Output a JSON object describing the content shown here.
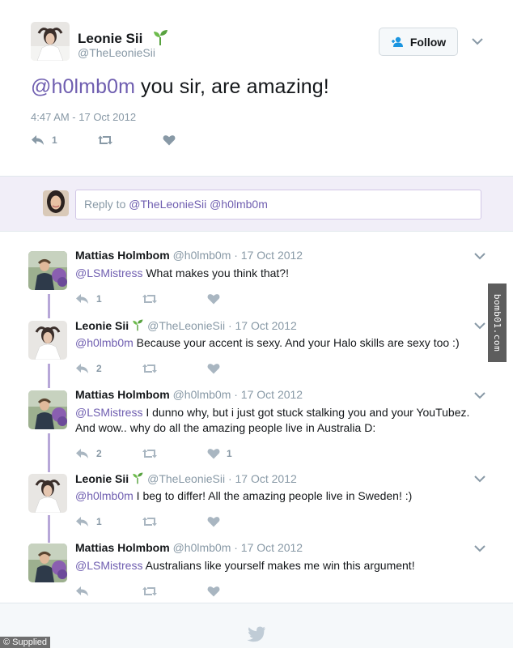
{
  "main_tweet": {
    "author_name": "Leonie Sii",
    "author_handle": "@TheLeonieSii",
    "follow_label": "Follow",
    "text_mention": "@h0lmb0m",
    "text_body": " you sir, are amazing!",
    "timestamp": "4:47 AM - 17 Oct 2012",
    "reply_count": "1",
    "like_count": ""
  },
  "reply_box": {
    "prefix": "Reply to ",
    "mention1": "@TheLeonieSii",
    "mention2": " @h0lmb0m"
  },
  "replies": [
    {
      "name": "Mattias Holmbom",
      "verified_sprout": false,
      "meta": "@h0lmb0m · 17 Oct 2012",
      "mention": "@LSMistress",
      "text": " What makes you think that?!",
      "reply_count": "1",
      "like_count": ""
    },
    {
      "name": "Leonie Sii",
      "verified_sprout": true,
      "meta": "@TheLeonieSii · 17 Oct 2012",
      "mention": "@h0lmb0m",
      "text": " Because your accent is sexy. And your Halo skills are sexy too :)",
      "reply_count": "2",
      "like_count": ""
    },
    {
      "name": "Mattias Holmbom",
      "verified_sprout": false,
      "meta": "@h0lmb0m · 17 Oct 2012",
      "mention": "@LSMistress",
      "text": " I dunno why, but i just got stuck stalking you and your YouTubez. And wow.. why do all the amazing people live in Australia D:",
      "reply_count": "2",
      "like_count": "1"
    },
    {
      "name": "Leonie Sii",
      "verified_sprout": true,
      "meta": "@TheLeonieSii · 17 Oct 2012",
      "mention": "@h0lmb0m",
      "text": " I beg to differ! All the amazing people live in Sweden! :)",
      "reply_count": "1",
      "like_count": ""
    },
    {
      "name": "Mattias Holmbom",
      "verified_sprout": false,
      "meta": "@h0lmb0m · 17 Oct 2012",
      "mention": "@LSMistress",
      "text": " Australians like yourself makes me win this argument!",
      "reply_count": "",
      "like_count": ""
    }
  ],
  "watermark": "bomb01.com",
  "credit": "© Supplied",
  "colors": {
    "mention": "#6f5eb0",
    "icon_gray": "#8899a6",
    "thread_line": "#b7a7d8",
    "reply_bar_bg": "#f1eef8"
  }
}
